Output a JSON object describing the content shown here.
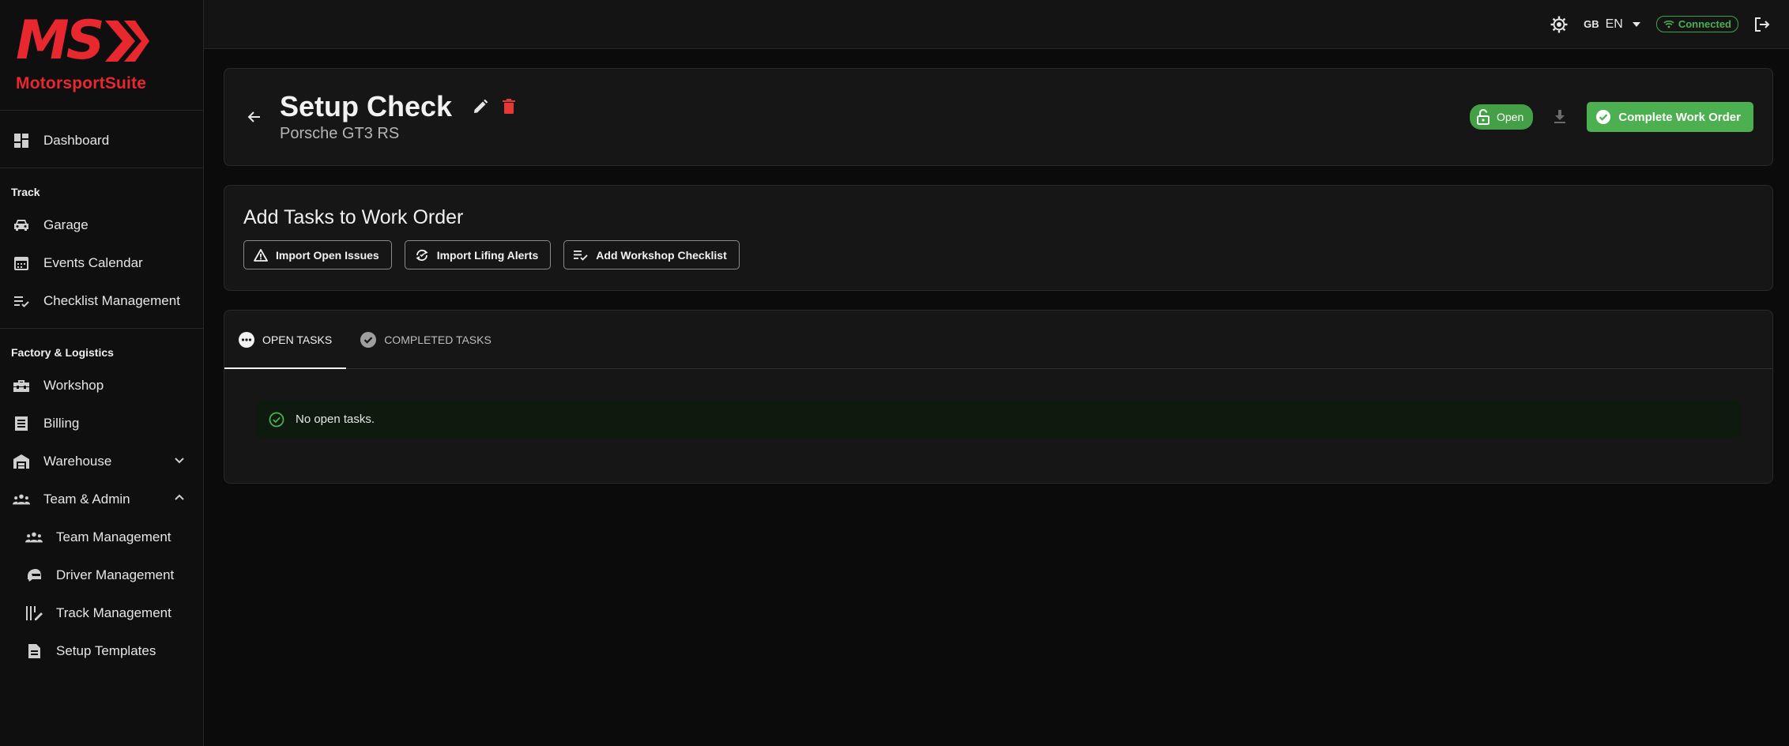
{
  "brand": {
    "logo_mark": "MS",
    "name": "MotorsportSuite",
    "color": "#e8282e"
  },
  "sidebar": {
    "dashboard": "Dashboard",
    "section_track": "Track",
    "track_items": [
      "Garage",
      "Events Calendar",
      "Checklist Management"
    ],
    "section_factory": "Factory & Logistics",
    "factory_items": [
      "Workshop",
      "Billing",
      "Warehouse",
      "Team & Admin"
    ],
    "admin_items": [
      "Team Management",
      "Driver Management",
      "Track Management",
      "Setup Templates"
    ]
  },
  "topbar": {
    "flag": "GB",
    "language": "EN",
    "connection": "Connected"
  },
  "work_order": {
    "title": "Setup Check",
    "vehicle": "Porsche GT3 RS",
    "status": "Open",
    "complete_label": "Complete Work Order"
  },
  "add_tasks": {
    "heading": "Add Tasks to Work Order",
    "import_issues": "Import Open Issues",
    "import_lifing": "Import Lifing Alerts",
    "add_checklist": "Add Workshop Checklist"
  },
  "tabs": {
    "open": "OPEN TASKS",
    "completed": "COMPLETED TASKS"
  },
  "notice": "No open tasks."
}
